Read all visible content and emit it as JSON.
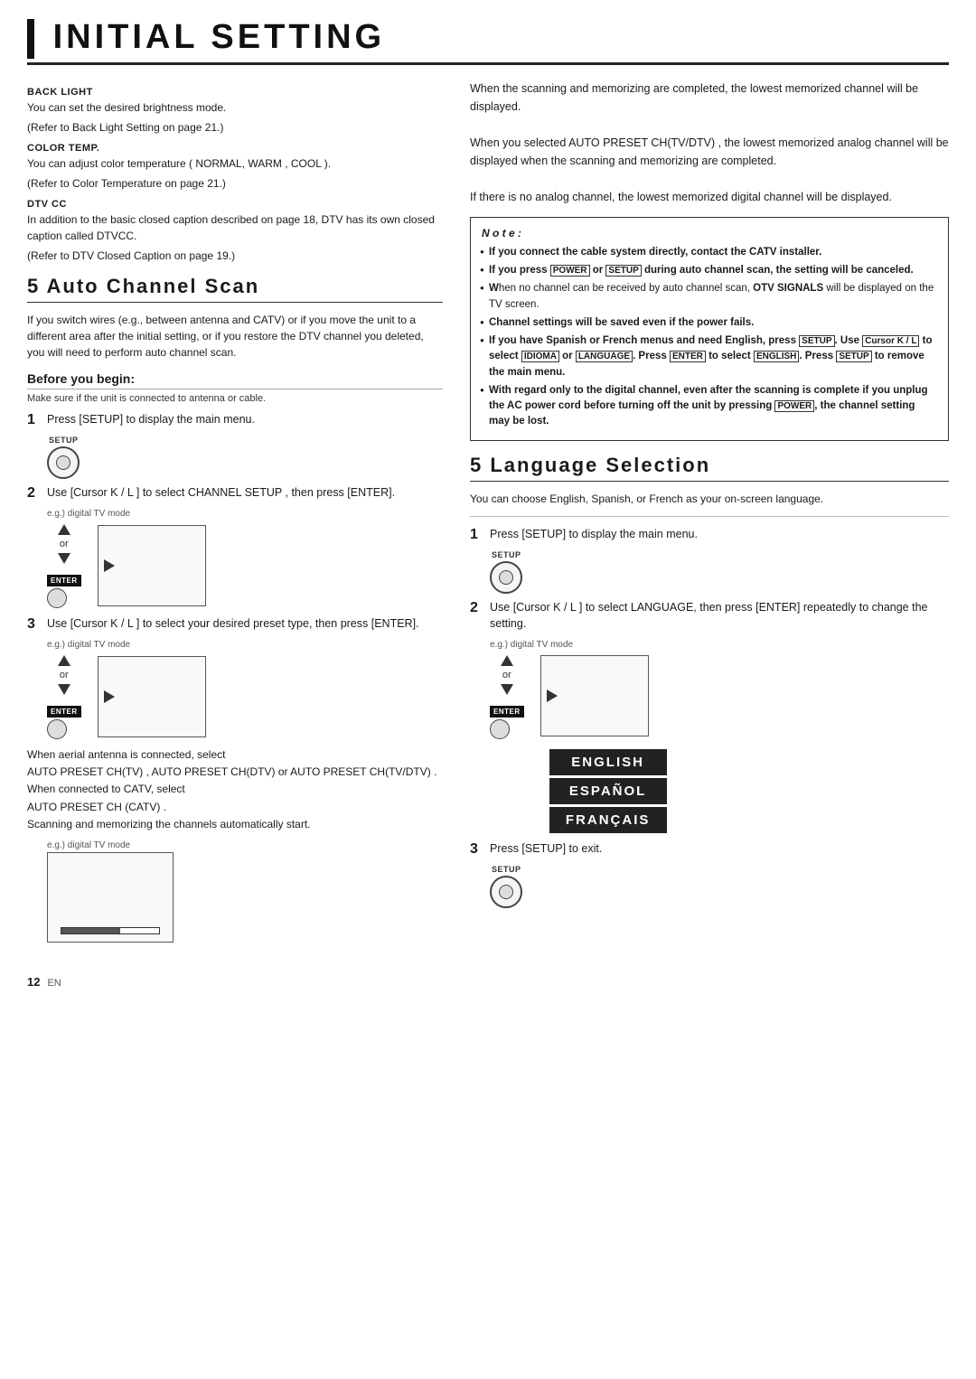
{
  "header": {
    "title": "INITIAL SETTING"
  },
  "left_col": {
    "intro_items": [
      {
        "label": "BACK LIGHT",
        "text1": "You can set the desired brightness mode.",
        "text2": "(Refer to  Back Light Setting  on page 21.)"
      },
      {
        "label": "COLOR TEMP.",
        "text1": "You can adjust color temperature ( NORMAL,  WARM ,  COOL ).",
        "text2": "(Refer to  Color Temperature  on page 21.)"
      },
      {
        "label": "DTV CC",
        "text1": "In addition to the basic closed caption described on page 18, DTV has its own closed caption called DTVCC.",
        "text2": "(Refer to  DTV Closed Caption  on page 19.)"
      }
    ],
    "section5_heading": "5 Auto Channel Scan",
    "section5_intro": "If you switch wires (e.g., between antenna and CATV) or if you move the unit to a different area after the initial setting, or if you restore the DTV channel you deleted, you will need to perform auto channel scan.",
    "before_begin": "Before you begin:",
    "before_begin_note": "Make sure if the unit is connected to antenna or cable.",
    "step1_text": "Press [SETUP] to display the main menu.",
    "setup_label": "SETUP",
    "step2_text": "Use [Cursor K / L ] to select  CHANNEL SETUP , then press [ENTER].",
    "eg_label1": "e.g.) digital TV mode",
    "step3_text": "Use [Cursor K / L ] to select your desired preset type, then press [ENTER].",
    "eg_label2": "e.g.) digital TV mode",
    "bottom_text1": "When aerial antenna is connected, select",
    "bottom_text2": " AUTO PRESET CH(TV) ,  AUTO PRESET CH(DTV)  or  AUTO PRESET CH(TV/DTV) .",
    "bottom_text3": "When connected to CATV, select",
    "bottom_text4": " AUTO PRESET CH (CATV) .",
    "bottom_text5": "Scanning and memorizing the channels automatically start.",
    "eg_label3": "e.g.) digital TV mode",
    "page_number": "12",
    "page_en": "EN"
  },
  "right_col": {
    "top_text": [
      "When the scanning and memorizing are completed, the lowest memorized channel will be displayed.",
      "When you selected  AUTO PRESET CH(TV/DTV) , the lowest memorized analog channel will be displayed when the scanning and memorizing are completed.",
      "If there is no analog channel, the lowest memorized digital channel will be displayed."
    ],
    "note_title": "N o t e :",
    "note_items": [
      "If you connect the cable system directly, contact the CATV installer.",
      "If you press POWER or SETUP during auto channel scan, the setting will be canceled.",
      "hen no channel can be received by auto channel scan, OTV SIGNALS will be displayed on the TV screen.",
      "Channel settings will be saved even if the power fails.",
      "If you have Spanish or French menus and need English, press SETUP. Use Cursor K / L to select IDIOMA or LANGUAGE. Press ENTER to select ENGLISH. Press SETUP to remove the main menu.",
      "ith regard only to the digital channel, even after the scanning is complete if you unplug the AC power cord before turning off the unit by pressing POWER, the channel setting may be lost."
    ],
    "section_lang_heading": "5 Language Selection",
    "lang_intro": "You can choose English, Spanish, or French as your on-screen language.",
    "lang_step1": "Press [SETUP] to display the main menu.",
    "lang_setup_label": "SETUP",
    "lang_step2": "Use [Cursor K / L ] to select  LANGUAGE, then press [ENTER] repeatedly to change the setting.",
    "lang_eg_label": "e.g.) digital TV mode",
    "lang_options": [
      "ENGLISH",
      "ESPAÑOL",
      "FRANÇAIS"
    ],
    "lang_step3": "Press [SETUP] to exit.",
    "lang_setup_label2": "SETUP"
  }
}
